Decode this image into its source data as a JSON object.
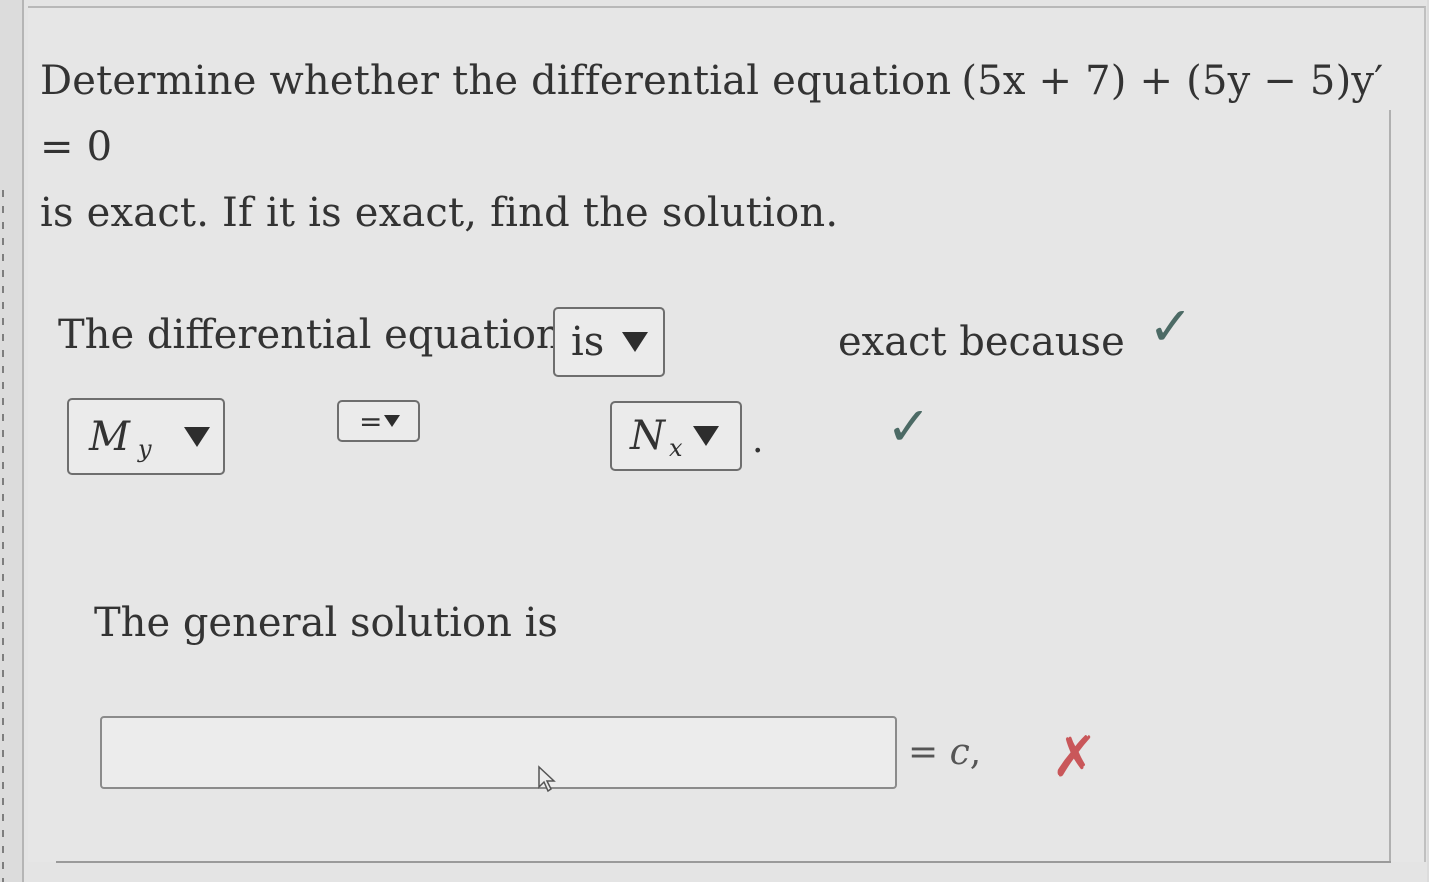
{
  "question": {
    "line1": "Determine whether the differential equation",
    "equation": "(5x + 7) + (5y − 5)y′ = 0",
    "line2": "is exact. If it is exact, find the solution."
  },
  "exactness": {
    "prefix": "The differential equation",
    "is_dropdown": "is",
    "suffix": "exact because",
    "status": "correct"
  },
  "condition": {
    "left_symbol": "M",
    "left_sub": "y",
    "relation": "=",
    "right_symbol": "N",
    "right_sub": "x",
    "end_punct": ".",
    "status": "correct"
  },
  "solution": {
    "label": "The general solution is",
    "input_value": "",
    "equals": "=",
    "constant": "c",
    "separator": ",",
    "status": "incorrect"
  },
  "icons": {
    "check": "✓",
    "cross": "✗"
  },
  "colors": {
    "correct": "#4c6a65",
    "incorrect": "#c9575a"
  }
}
